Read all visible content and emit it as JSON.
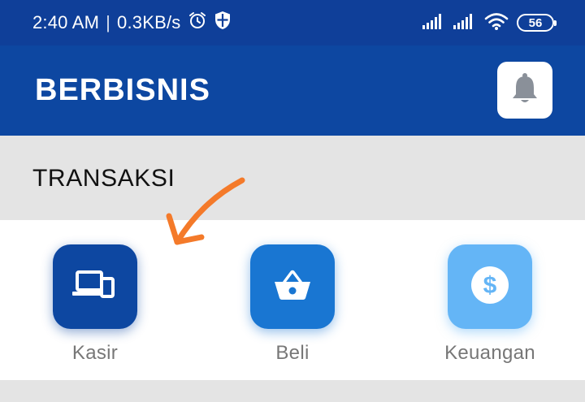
{
  "status_bar": {
    "time": "2:40 AM",
    "separator": "|",
    "net_speed": "0.3KB/s",
    "battery_level": "56",
    "icons": [
      "alarm-icon",
      "shield-icon",
      "signal-icon",
      "signal-icon",
      "wifi-icon",
      "battery-icon"
    ]
  },
  "app_bar": {
    "title": "BERBISNIS",
    "notification_icon": "bell-icon"
  },
  "section": {
    "title": "TRANSAKSI"
  },
  "menu": {
    "items": [
      {
        "label": "Kasir",
        "icon": "pos-devices-icon",
        "color": "#0d47a1"
      },
      {
        "label": "Beli",
        "icon": "basket-icon",
        "color": "#1976d2"
      },
      {
        "label": "Keuangan",
        "icon": "dollar-icon",
        "color": "#64b5f6"
      }
    ]
  },
  "annotation": {
    "color": "#f47a2a",
    "icon": "hand-drawn-arrow-icon"
  }
}
